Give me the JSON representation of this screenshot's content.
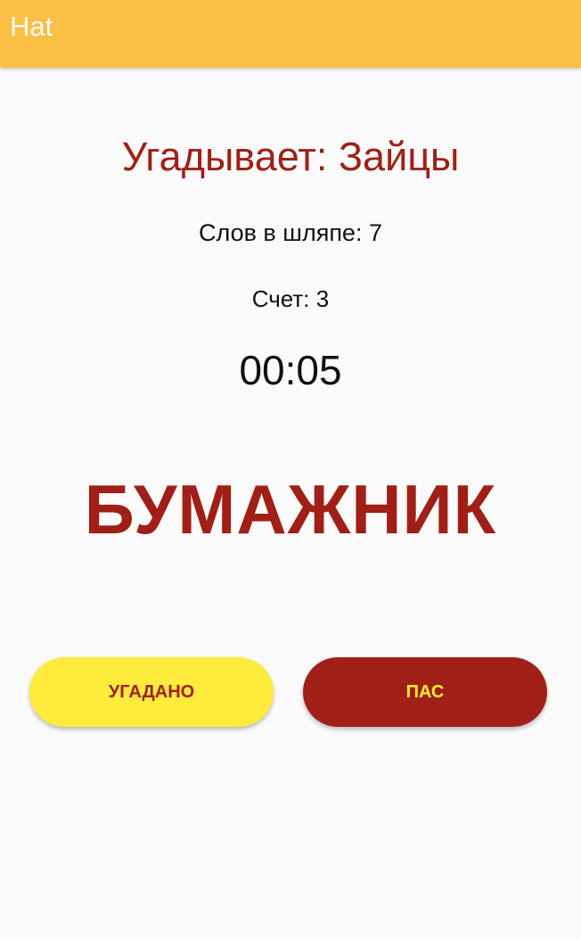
{
  "app_bar": {
    "title": "Hat"
  },
  "game": {
    "guessing_team": "Угадывает: Зайцы",
    "words_in_hat": "Слов в шляпе:  7",
    "score": "Счет: 3",
    "timer": "00:05",
    "current_word": "БУМАЖНИК"
  },
  "buttons": {
    "guessed_label": "УГАДАНО",
    "pass_label": "ПАС"
  },
  "colors": {
    "app_bar": "#fbbf45",
    "accent_red": "#a01f17",
    "accent_yellow": "#ffeb3b",
    "background": "#fafafa"
  }
}
